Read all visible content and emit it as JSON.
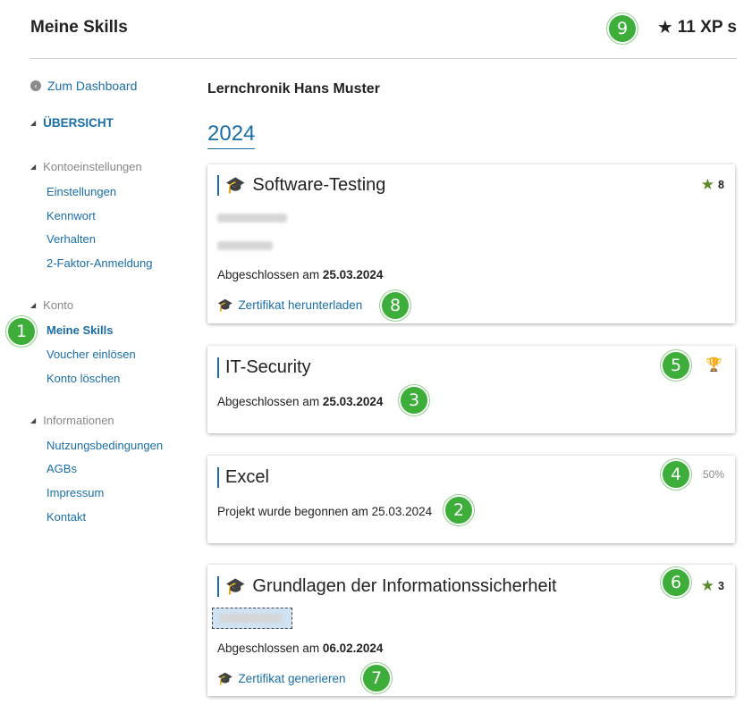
{
  "header": {
    "title": "Meine Skills",
    "xp_total": "11 XP s",
    "xp_icon": "star-icon"
  },
  "sidebar": {
    "back_label": "Zum Dashboard",
    "overview_label": "ÜBERSICHT",
    "groups": [
      {
        "heading": "Kontoeinstellungen",
        "items": [
          "Einstellungen",
          "Kennwort",
          "Verhalten",
          "2-Faktor-Anmeldung"
        ]
      },
      {
        "heading": "Konto",
        "items": [
          "Meine Skills",
          "Voucher einlösen",
          "Konto löschen"
        ]
      },
      {
        "heading": "Informationen",
        "items": [
          "Nutzungsbedingungen",
          "AGBs",
          "Impressum",
          "Kontakt"
        ]
      }
    ],
    "current_item": "Meine Skills"
  },
  "main": {
    "chronicle_title": "Lernchronik Hans Muster",
    "year": "2024",
    "cards": [
      {
        "title": "Software-Testing",
        "icon": "graduation-cap-icon",
        "score": "8",
        "completed_prefix": "Abgeschlossen am",
        "completed_date": "25.03.2024",
        "link_label": "Zertifikat herunterladen"
      },
      {
        "title": "IT-Security",
        "score_icon": "trophy-icon",
        "completed_prefix": "Abgeschlossen am",
        "completed_date": "25.03.2024"
      },
      {
        "title": "Excel",
        "progress_label": "50%",
        "progress": 0.5,
        "started_text": "Projekt wurde begonnen am 25.03.2024"
      },
      {
        "title": "Grundlagen der Informationssicherheit",
        "icon": "graduation-cap-icon",
        "score": "3",
        "completed_prefix": "Abgeschlossen am",
        "completed_date": "06.02.2024",
        "link_label": "Zertifikat generieren"
      }
    ]
  },
  "annotations": [
    "1",
    "2",
    "3",
    "4",
    "5",
    "6",
    "7",
    "8",
    "9"
  ],
  "colors": {
    "link": "#1a6ea8",
    "badge": "#3dae3a",
    "score_star": "#5a8a2a"
  }
}
